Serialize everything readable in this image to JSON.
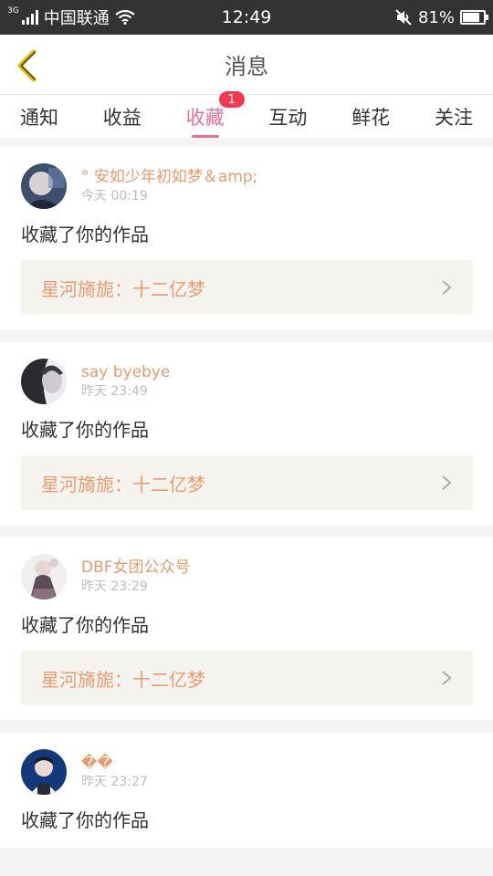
{
  "status_bar": {
    "network": "3G",
    "carrier": "中国联通",
    "time": "12:49",
    "battery": "81%",
    "battery_level": 0.81,
    "icons": [
      "signal-icon",
      "wifi-icon",
      "mute-icon",
      "battery-icon"
    ]
  },
  "header": {
    "title": "消息",
    "back_icon": "chevron-left-icon",
    "accent_color": "#e8b900"
  },
  "tabs": [
    {
      "label": "通知"
    },
    {
      "label": "收益"
    },
    {
      "label": "收藏",
      "badge": "1",
      "active": true
    },
    {
      "label": "互动"
    },
    {
      "label": "鲜花"
    },
    {
      "label": "关注"
    }
  ],
  "colors": {
    "active_tab": "#e76fa0",
    "username": "#e99b6b",
    "badge": "#f2394f",
    "work_bg": "#f4f3ee"
  },
  "items": [
    {
      "user": "° 安如少年初如梦＆amp;",
      "time": "今天 00:19",
      "action": "收藏了你的作品",
      "work": "星河旖旎：十二亿梦"
    },
    {
      "user": "say byebye",
      "time": "昨天 23:49",
      "action": "收藏了你的作品",
      "work": "星河旖旎：十二亿梦"
    },
    {
      "user": "DBF女团公众号",
      "time": "昨天 23:29",
      "action": "收藏了你的作品",
      "work": "星河旖旎：十二亿梦"
    },
    {
      "user": "��",
      "time": "昨天 23:27",
      "action": "收藏了你的作品",
      "work": ""
    }
  ]
}
